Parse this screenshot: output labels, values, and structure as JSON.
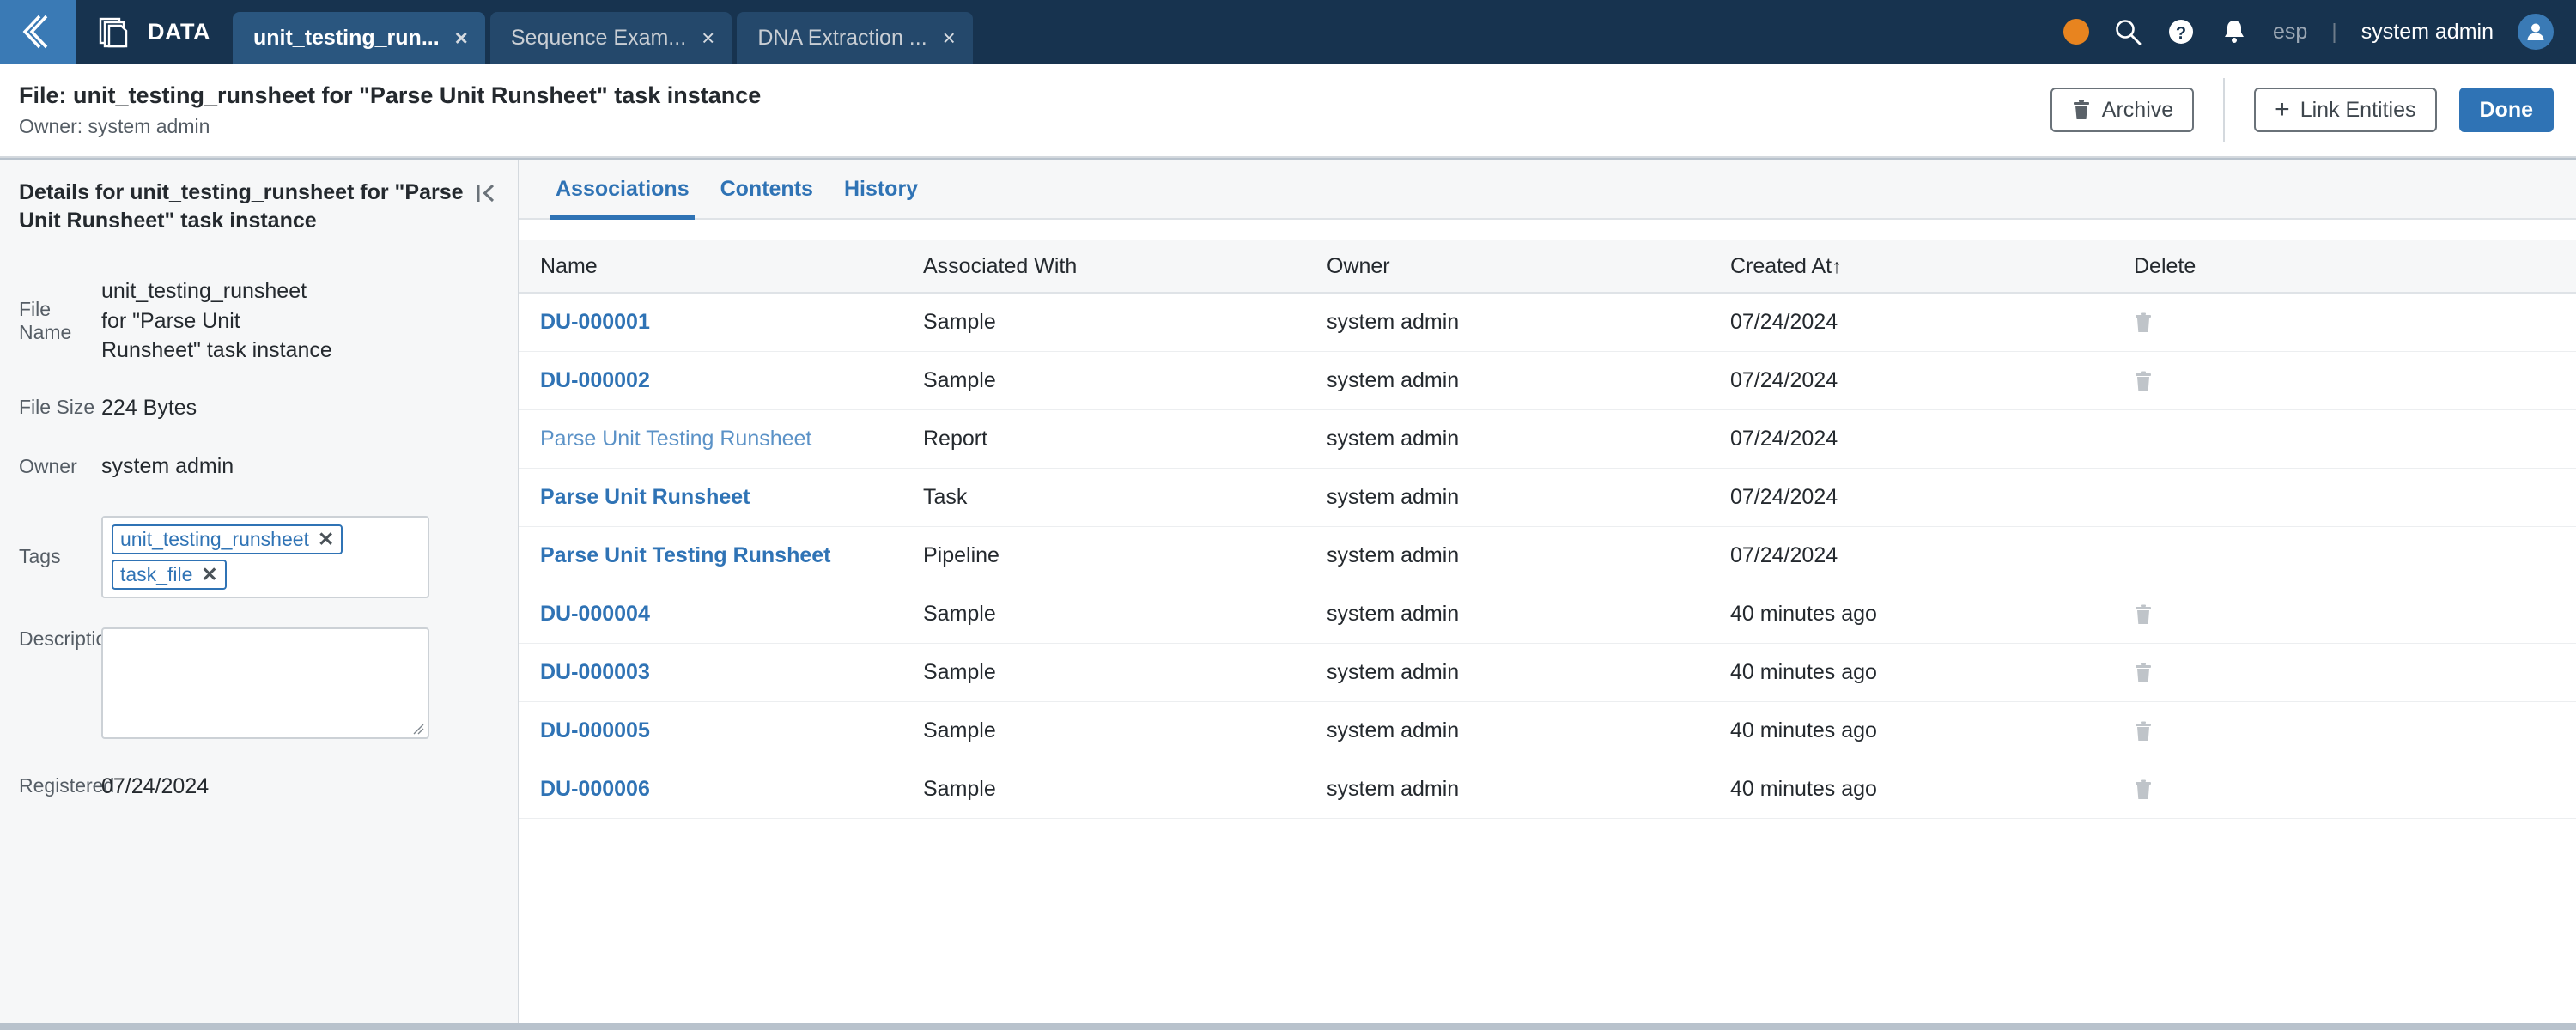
{
  "topbar": {
    "back_icon": "chevron-left-icon",
    "app_icon": "documents-icon",
    "app_label": "DATA",
    "tabs": [
      {
        "label": "unit_testing_run...",
        "close": "×",
        "active": true
      },
      {
        "label": "Sequence Exam...",
        "close": "×",
        "active": false
      },
      {
        "label": "DNA Extraction ...",
        "close": "×",
        "active": false
      }
    ],
    "status_dot_color": "#e8841f",
    "icons": [
      "status-dot",
      "search-icon",
      "help-icon",
      "notifications-bell-icon"
    ],
    "language": "esp",
    "separator": "|",
    "user_name": "system admin",
    "avatar_icon": "user-avatar-icon"
  },
  "pagehead": {
    "title": "File: unit_testing_runsheet for \"Parse Unit Runsheet\" task instance",
    "subtitle": "Owner: system admin",
    "archive_label": "Archive",
    "archive_icon": "trash-icon",
    "link_entities_label": "Link Entities",
    "link_entities_icon": "plus-icon",
    "done_label": "Done",
    "accent_color": "#2f73b5"
  },
  "details": {
    "title": "Details for unit_testing_runsheet for \"Parse Unit Runsheet\" task instance",
    "collapse_icon": "collapse-panel-icon",
    "fields": {
      "file_name_label": "File Name",
      "file_name_value": "unit_testing_runsheet for \"Parse Unit Runsheet\" task instance",
      "file_size_label": "File Size",
      "file_size_value": "224 Bytes",
      "owner_label": "Owner",
      "owner_value": "system admin",
      "tags_label": "Tags",
      "description_label": "Description",
      "description_value": "",
      "registered_label": "Registered",
      "registered_value": "07/24/2024"
    },
    "tags": [
      {
        "label": "unit_testing_runsheet",
        "remove": "✕"
      },
      {
        "label": "task_file",
        "remove": "✕"
      }
    ]
  },
  "content": {
    "tabs": [
      {
        "label": "Associations",
        "active": true
      },
      {
        "label": "Contents",
        "active": false
      },
      {
        "label": "History",
        "active": false
      }
    ],
    "table": {
      "columns": [
        "Name",
        "Associated With",
        "Owner",
        "Created At",
        "Delete"
      ],
      "sort_column": "Created At",
      "sort_arrow": "↑",
      "rows": [
        {
          "name": "DU-000001",
          "name_style": "bold",
          "associated_with": "Sample",
          "owner": "system admin",
          "created_at": "07/24/2024",
          "delete": true
        },
        {
          "name": "DU-000002",
          "name_style": "bold",
          "associated_with": "Sample",
          "owner": "system admin",
          "created_at": "07/24/2024",
          "delete": true
        },
        {
          "name": "Parse Unit Testing Runsheet",
          "name_style": "normal",
          "associated_with": "Report",
          "owner": "system admin",
          "created_at": "07/24/2024",
          "delete": false
        },
        {
          "name": "Parse Unit Runsheet",
          "name_style": "bold",
          "associated_with": "Task",
          "owner": "system admin",
          "created_at": "07/24/2024",
          "delete": false
        },
        {
          "name": "Parse Unit Testing Runsheet",
          "name_style": "bold",
          "associated_with": "Pipeline",
          "owner": "system admin",
          "created_at": "07/24/2024",
          "delete": false
        },
        {
          "name": "DU-000004",
          "name_style": "bold",
          "associated_with": "Sample",
          "owner": "system admin",
          "created_at": "40 minutes ago",
          "delete": true
        },
        {
          "name": "DU-000003",
          "name_style": "bold",
          "associated_with": "Sample",
          "owner": "system admin",
          "created_at": "40 minutes ago",
          "delete": true
        },
        {
          "name": "DU-000005",
          "name_style": "bold",
          "associated_with": "Sample",
          "owner": "system admin",
          "created_at": "40 minutes ago",
          "delete": true
        },
        {
          "name": "DU-000006",
          "name_style": "bold",
          "associated_with": "Sample",
          "owner": "system admin",
          "created_at": "40 minutes ago",
          "delete": true
        }
      ]
    }
  }
}
